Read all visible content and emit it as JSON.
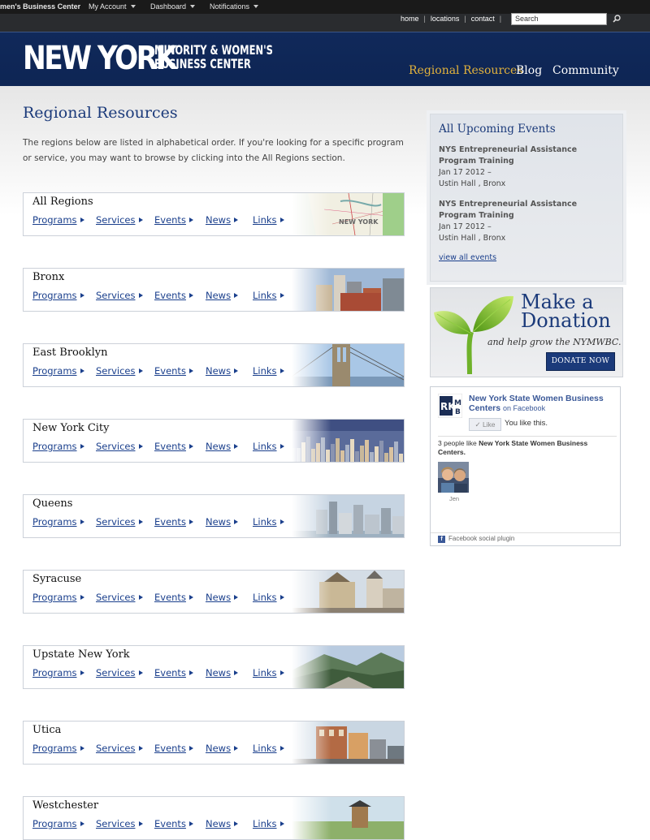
{
  "adminbar": {
    "site": "men's Business Center",
    "menus": [
      "My Account",
      "Dashboard",
      "Notifications"
    ]
  },
  "util": {
    "links": [
      "home",
      "locations",
      "contact"
    ],
    "search_placeholder": "Search"
  },
  "header": {
    "logo_main": "NEW YORK",
    "logo_line1": "MINORITY & WOMEN'S",
    "logo_line2": "BUSINESS CENTER",
    "nav": [
      "Regional Resources",
      "Blog",
      "Community"
    ],
    "active_nav": "Regional Resources",
    "active_color": "#e2b23c"
  },
  "main": {
    "title": "Regional Resources",
    "intro": "The regions below are listed in alphabetical order. If you're looking for a specific program or service, you may want to browse by clicking into the All Regions section.",
    "link_labels": [
      "Programs",
      "Services",
      "Events",
      "News",
      "Links"
    ],
    "regions": [
      {
        "name": "All Regions",
        "image": "map"
      },
      {
        "name": "Bronx",
        "image": "city-bronx"
      },
      {
        "name": "East Brooklyn",
        "image": "bridge"
      },
      {
        "name": "New York City",
        "image": "city-aerial"
      },
      {
        "name": "Queens",
        "image": "skyline"
      },
      {
        "name": "Syracuse",
        "image": "towers"
      },
      {
        "name": "Upstate New York",
        "image": "mountains"
      },
      {
        "name": "Utica",
        "image": "street"
      },
      {
        "name": "Westchester",
        "image": "park"
      }
    ]
  },
  "sidebar": {
    "events_title": "All Upcoming Events",
    "events": [
      {
        "title": "NYS Entrepreneurial Assistance Program Training",
        "date": "Jan 17 2012 –",
        "location": "Ustin Hall , Bronx"
      },
      {
        "title": "NYS Entrepreneurial Assistance Program Training",
        "date": "Jan 17 2012 –",
        "location": "Ustin Hall , Bronx"
      }
    ],
    "view_all": "view all events",
    "donate": {
      "line1": "Make a",
      "line2": "Donation",
      "help": "and help grow the NYMWBC.",
      "button": "DONATE NOW"
    },
    "facebook": {
      "page_name": "New York State Women Business Centers",
      "on": "on Facebook",
      "like": "Like",
      "you_like": "You like this.",
      "people_prefix": "3 people like",
      "people_page": "New York State Women Business Centers.",
      "avatar_name": "Jen",
      "footer": "Facebook social plugin",
      "logo_text": "RK M B"
    }
  }
}
